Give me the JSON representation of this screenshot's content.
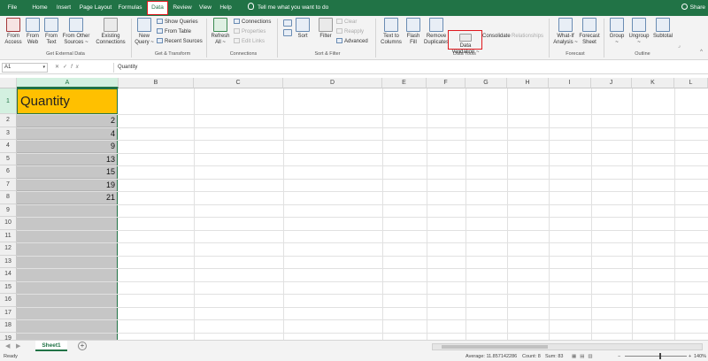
{
  "tabs": [
    "File",
    "Home",
    "Insert",
    "Page Layout",
    "Formulas",
    "Data",
    "Review",
    "View",
    "Help"
  ],
  "active_tab": "Data",
  "tell_me": "Tell me what you want to do",
  "share": "Share",
  "ribbon": {
    "get_external": {
      "from_access": [
        "From",
        "Access"
      ],
      "from_web": [
        "From",
        "Web"
      ],
      "from_text": [
        "From",
        "Text"
      ],
      "from_other": [
        "From Other",
        "Sources ~"
      ],
      "existing": [
        "Existing",
        "Connections"
      ],
      "label": "Get External Data"
    },
    "get_transform": {
      "new_query": [
        "New",
        "Query ~"
      ],
      "show_queries": "Show Queries",
      "from_table": "From Table",
      "recent_sources": "Recent Sources",
      "label": "Get & Transform"
    },
    "connections": {
      "refresh": [
        "Refresh",
        "All ~"
      ],
      "connections": "Connections",
      "properties": "Properties",
      "edit_links": "Edit Links",
      "label": "Connections"
    },
    "sort_filter": {
      "sort": "Sort",
      "filter": "Filter",
      "clear": "Clear",
      "reapply": "Reapply",
      "advanced": "Advanced",
      "label": "Sort & Filter"
    },
    "data_tools": {
      "text_to_columns": [
        "Text to",
        "Columns"
      ],
      "flash_fill": [
        "Flash",
        "Fill"
      ],
      "remove_duplicates": [
        "Remove",
        "Duplicates"
      ],
      "data_validation": [
        "Data",
        "Validation ~"
      ],
      "consolidate": "Consolidate",
      "relationships": "Relationships",
      "label": "Data Tools"
    },
    "forecast": {
      "what_if": [
        "What-If",
        "Analysis ~"
      ],
      "forecast_sheet": [
        "Forecast",
        "Sheet"
      ],
      "label": "Forecast"
    },
    "outline": {
      "group": [
        "Group",
        "~"
      ],
      "ungroup": [
        "Ungroup",
        "~"
      ],
      "subtotal": "Subtotal",
      "label": "Outline"
    }
  },
  "formula_bar": {
    "name_box": "A1",
    "content": "Quantity"
  },
  "columns": [
    "A",
    "B",
    "C",
    "D",
    "E",
    "F",
    "G",
    "H",
    "I",
    "J",
    "K",
    "L"
  ],
  "rows": [
    "1",
    "2",
    "3",
    "4",
    "5",
    "6",
    "7",
    "8",
    "9",
    "10",
    "11",
    "12",
    "13",
    "14",
    "15",
    "16",
    "17",
    "18",
    "19"
  ],
  "cells": {
    "a1": "Quantity",
    "values": [
      "2",
      "4",
      "9",
      "13",
      "15",
      "19",
      "21"
    ]
  },
  "sheet_tab": "Sheet1",
  "status": {
    "ready": "Ready",
    "average": "Average: 11.857142286",
    "count": "Count: 8",
    "sum": "Sum: 83",
    "zoom": "140%"
  },
  "colors": {
    "excel_green": "#217346",
    "header_fill": "#ffc000",
    "highlight_red": "#e0191e"
  }
}
